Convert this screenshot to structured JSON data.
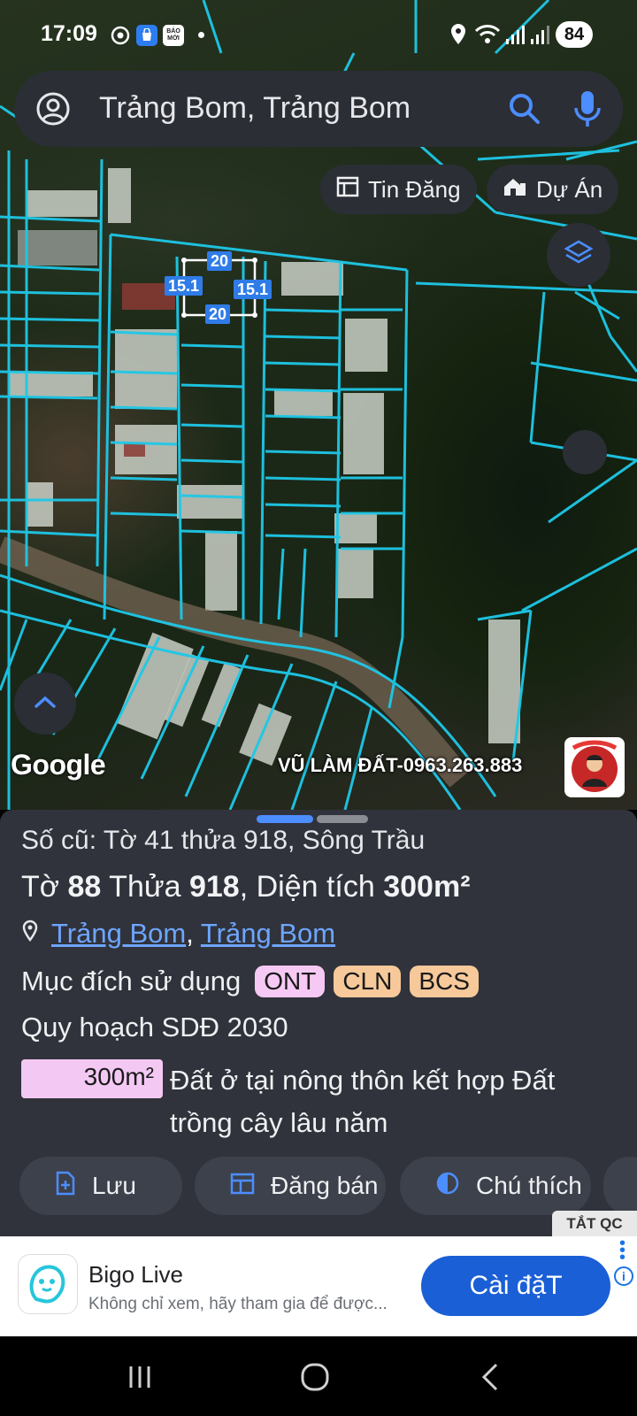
{
  "status_bar": {
    "time": "17:09",
    "app_icon_label": "BÁO MỚI",
    "battery": "84"
  },
  "search": {
    "query": "Trảng Bom, Trảng Bom"
  },
  "map": {
    "chips": [
      {
        "label": "Tin Đăng",
        "icon": "listing-icon"
      },
      {
        "label": "Dự Án",
        "icon": "project-icon"
      }
    ],
    "dimensions": [
      "20",
      "15.1",
      "15.1",
      "20"
    ],
    "google_label": "Google",
    "watermark": "VŨ LÀM ĐẤT-0963.263.883"
  },
  "sheet": {
    "old_number": "Số cũ: Tờ 41 thửa 918, Sông Trầu",
    "main": {
      "to_label": "Tờ ",
      "to_value": "88",
      "thua_label": " Thửa ",
      "thua_value": "918",
      "area_label": ", Diện tích ",
      "area_value": "300m²"
    },
    "location": {
      "part1": "Trảng Bom",
      "separator": ", ",
      "part2": "Trảng Bom"
    },
    "purpose_label": "Mục đích sử dụng",
    "tags": [
      {
        "code": "ONT",
        "color": "#f6c9f4"
      },
      {
        "code": "CLN",
        "color": "#f7c99a"
      },
      {
        "code": "BCS",
        "color": "#f7c99a"
      }
    ],
    "planning_label": "Quy hoạch SDĐ 2030",
    "planning_area": "300m²",
    "planning_desc": "Đất ở tại nông thôn kết hợp Đất trồng cây lâu năm",
    "actions": [
      {
        "label": "Lưu",
        "icon": "save-icon"
      },
      {
        "label": "Đăng bán",
        "icon": "post-sale-icon"
      },
      {
        "label": "Chú thích",
        "icon": "legend-icon"
      }
    ],
    "hide_ads": "TẮT QC"
  },
  "ad": {
    "title": "Bigo Live",
    "subtitle": "Không chỉ xem, hãy tham gia để được...",
    "cta": "Cài đặT"
  },
  "colors": {
    "parcel_line": "#1ec8e8",
    "accent_blue": "#2f7ce8",
    "sheet_bg": "#30333b"
  }
}
